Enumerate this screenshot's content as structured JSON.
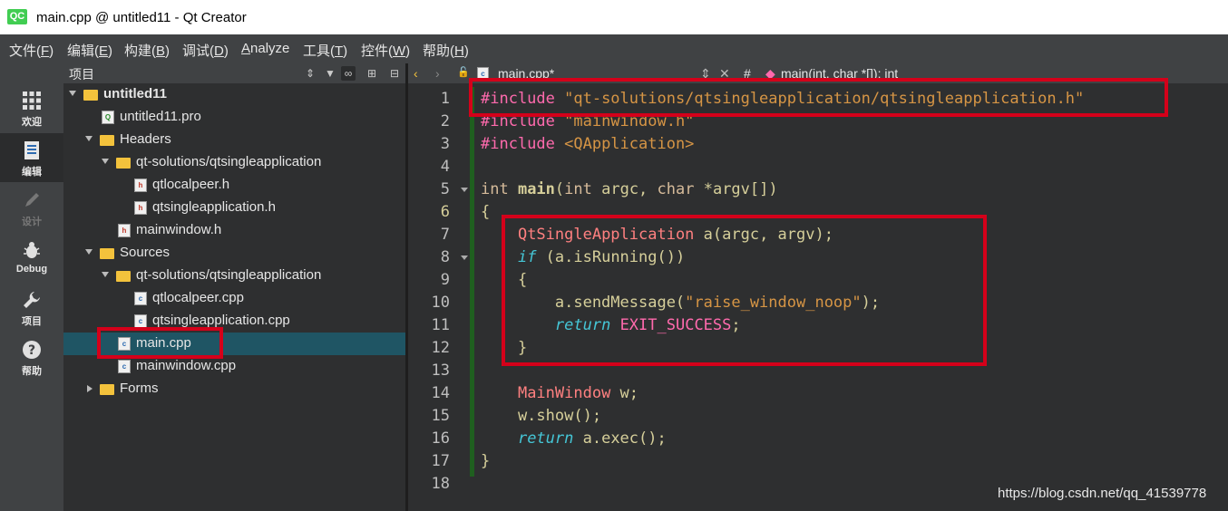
{
  "window": {
    "title": "main.cpp @ untitled11 - Qt Creator",
    "logo": "QC"
  },
  "menu": [
    {
      "label": "文件(",
      "key": "F",
      "end": ")"
    },
    {
      "label": "编辑(",
      "key": "E",
      "end": ")"
    },
    {
      "label": "构建(",
      "key": "B",
      "end": ")"
    },
    {
      "label": "调试(",
      "key": "D",
      "end": ")"
    },
    {
      "label": "",
      "key": "A",
      "end": "nalyze"
    },
    {
      "label": "工具(",
      "key": "T",
      "end": ")"
    },
    {
      "label": "控件(",
      "key": "W",
      "end": ")"
    },
    {
      "label": "帮助(",
      "key": "H",
      "end": ")"
    }
  ],
  "modes": [
    {
      "label": "欢迎",
      "icon": "grid-icon"
    },
    {
      "label": "编辑",
      "icon": "edit-doc-icon"
    },
    {
      "label": "设计",
      "icon": "pencil-icon"
    },
    {
      "label": "Debug",
      "icon": "bug-icon"
    },
    {
      "label": "项目",
      "icon": "wrench-icon"
    },
    {
      "label": "帮助",
      "icon": "help-icon"
    }
  ],
  "project_panel": {
    "title": "项目"
  },
  "tree": [
    {
      "text": "untitled11",
      "bold": true
    },
    {
      "text": "untitled11.pro"
    },
    {
      "text": "Headers"
    },
    {
      "text": "qt-solutions/qtsingleapplication"
    },
    {
      "text": "qtlocalpeer.h"
    },
    {
      "text": "qtsingleapplication.h"
    },
    {
      "text": "mainwindow.h"
    },
    {
      "text": "Sources"
    },
    {
      "text": "qt-solutions/qtsingleapplication"
    },
    {
      "text": "qtlocalpeer.cpp"
    },
    {
      "text": "qtsingleapplication.cpp"
    },
    {
      "text": "main.cpp"
    },
    {
      "text": "mainwindow.cpp"
    },
    {
      "text": "Forms"
    }
  ],
  "editor": {
    "file_tab": "main.cpp*",
    "hash": "#",
    "symbol": "main(int, char *[]): int",
    "current_line": 6
  },
  "line_numbers": [
    "1",
    "2",
    "3",
    "4",
    "5",
    "6",
    "7",
    "8",
    "9",
    "10",
    "11",
    "12",
    "13",
    "14",
    "15",
    "16",
    "17",
    "18"
  ],
  "code": {
    "l1a": "#include ",
    "l1b": "\"qt-solutions/qtsingleapplication/qtsingleapplication.h\"",
    "l2a": "#include ",
    "l2b": "\"mainwindow.h\"",
    "l3a": "#include ",
    "l3b": "<QApplication>",
    "l5a": "int ",
    "l5b": "main",
    "l5c": "(",
    "l5d": "int",
    "l5e": " argc, ",
    "l5f": "char",
    "l5g": " *argv[])",
    "l6": "{",
    "l7a": "    ",
    "l7b": "QtSingleApplication",
    "l7c": " a(argc, argv);",
    "l8a": "    ",
    "l8b": "if",
    "l8c": " (a.isRunning())",
    "l9": "    {",
    "l10a": "        a.sendMessage(",
    "l10b": "\"raise_window_noop\"",
    "l10c": ");",
    "l11a": "        ",
    "l11b": "return",
    "l11c": " ",
    "l11d": "EXIT_SUCCESS",
    "l11e": ";",
    "l12": "    }",
    "l14a": "    ",
    "l14b": "MainWindow",
    "l14c": " w;",
    "l15": "    w.show();",
    "l16a": "    ",
    "l16b": "return",
    "l16c": " a.exec();",
    "l17": "}"
  },
  "watermark": "https://blog.csdn.net/qq_41539778"
}
